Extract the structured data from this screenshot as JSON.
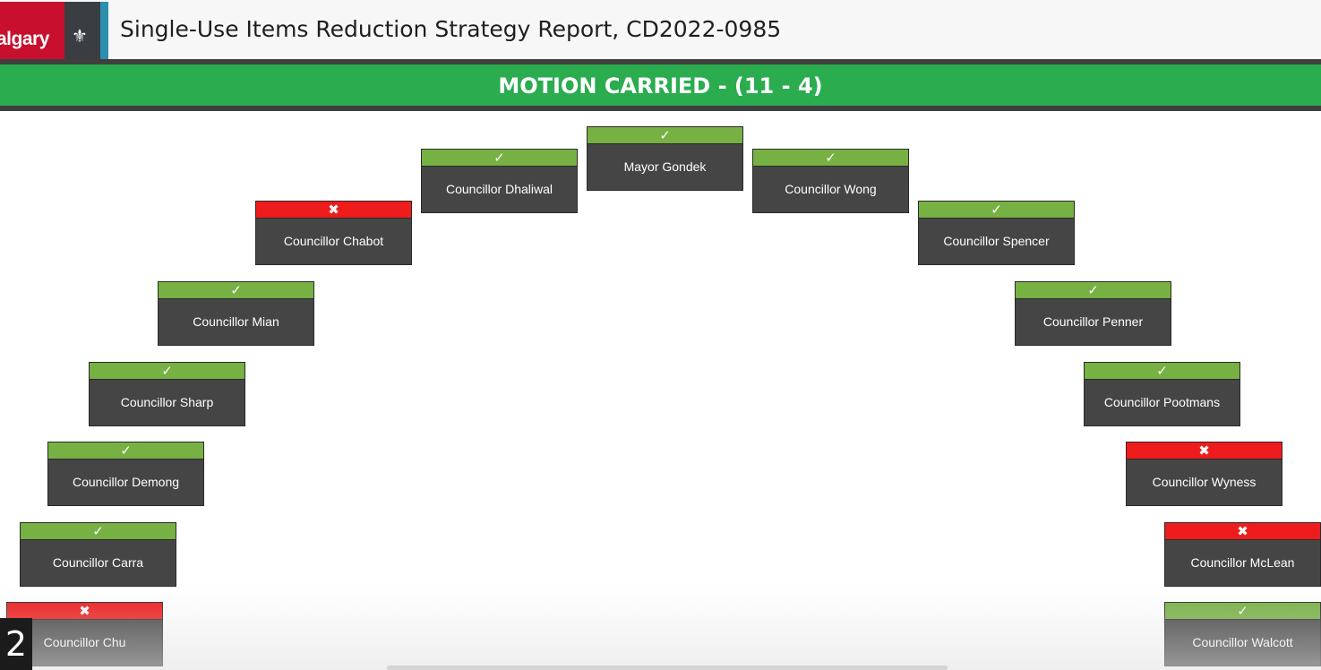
{
  "header": {
    "logo_text": "algary",
    "crest_glyph": "⚜",
    "title": "Single-Use Items Reduction Strategy Report, CD2022-0985"
  },
  "banner": {
    "text": "MOTION CARRIED - (11 - 4)"
  },
  "vote_icons": {
    "yes": "✓",
    "no": "✖"
  },
  "colors": {
    "yes": "#77b043",
    "no": "#ee1c1c",
    "banner": "#2aac4f",
    "card": "#454545"
  },
  "members": [
    {
      "name": "Mayor Gondek",
      "vote": "yes",
      "icon": "✓"
    },
    {
      "name": "Councillor Dhaliwal",
      "vote": "yes",
      "icon": "✓"
    },
    {
      "name": "Councillor Wong",
      "vote": "yes",
      "icon": "✓"
    },
    {
      "name": "Councillor Chabot",
      "vote": "no",
      "icon": "✖"
    },
    {
      "name": "Councillor Spencer",
      "vote": "yes",
      "icon": "✓"
    },
    {
      "name": "Councillor Mian",
      "vote": "yes",
      "icon": "✓"
    },
    {
      "name": "Councillor Penner",
      "vote": "yes",
      "icon": "✓"
    },
    {
      "name": "Councillor Sharp",
      "vote": "yes",
      "icon": "✓"
    },
    {
      "name": "Councillor Pootmans",
      "vote": "yes",
      "icon": "✓"
    },
    {
      "name": "Councillor Demong",
      "vote": "yes",
      "icon": "✓"
    },
    {
      "name": "Councillor Wyness",
      "vote": "no",
      "icon": "✖"
    },
    {
      "name": "Councillor Carra",
      "vote": "yes",
      "icon": "✓"
    },
    {
      "name": "Councillor McLean",
      "vote": "no",
      "icon": "✖"
    },
    {
      "name": "Councillor Chu",
      "vote": "no",
      "icon": "✖"
    },
    {
      "name": "Councillor Walcott",
      "vote": "yes",
      "icon": "✓"
    }
  ],
  "page_number": "2"
}
